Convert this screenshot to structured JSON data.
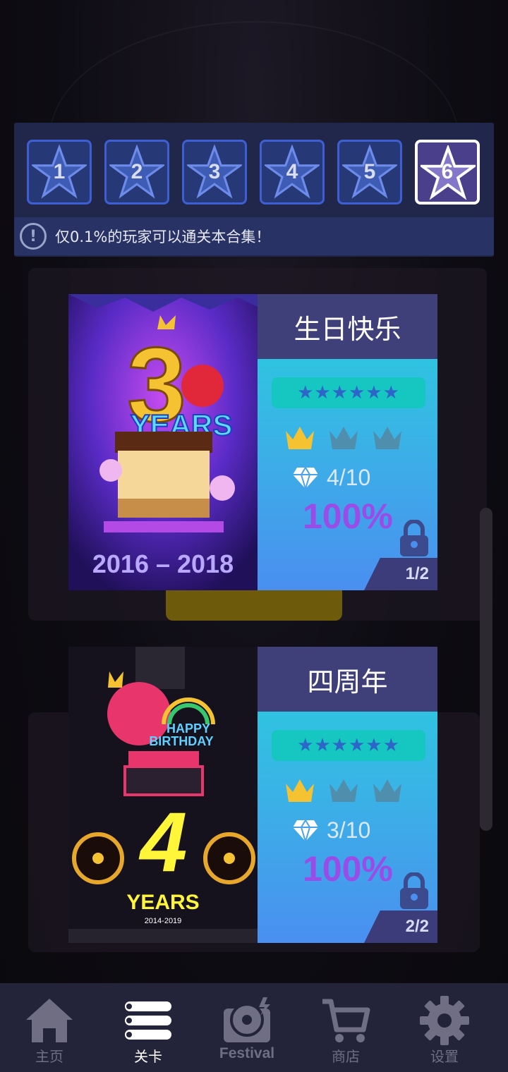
{
  "levels": [
    "1",
    "2",
    "3",
    "4",
    "5",
    "6"
  ],
  "active_level": "6",
  "notice": {
    "icon": "exclamation-icon",
    "text": "仅0.1%的玩家可以通关本合集！"
  },
  "collections": [
    {
      "title": "生日快乐",
      "stars": "★★★★★★",
      "crowns_earned": 1,
      "crowns_total": 3,
      "gems": "4/10",
      "percent": "100%",
      "page": "1/2",
      "locked": true,
      "art": {
        "number": "3",
        "years": "YEARS",
        "dates": "2016 – 2018"
      }
    },
    {
      "title": "四周年",
      "stars": "★★★★★★",
      "crowns_earned": 1,
      "crowns_total": 3,
      "gems": "3/10",
      "percent": "100%",
      "page": "2/2",
      "locked": true,
      "art": {
        "number": "4",
        "years": "YEARS",
        "dates": "2014-2019",
        "happy": "HAPPY",
        "birthday": "BIRTHDAY"
      }
    }
  ],
  "nav": [
    {
      "label": "主页",
      "icon": "home-icon"
    },
    {
      "label": "关卡",
      "icon": "list-icon",
      "active": true
    },
    {
      "label": "Festival",
      "icon": "festival-disc-icon"
    },
    {
      "label": "商店",
      "icon": "cart-icon"
    },
    {
      "label": "设置",
      "icon": "gear-icon"
    }
  ],
  "colors": {
    "gold": "#f5c232",
    "crown_gray": "#4f8fad",
    "accent_purple": "#9a4ce8",
    "nav_bg": "#23233a"
  }
}
